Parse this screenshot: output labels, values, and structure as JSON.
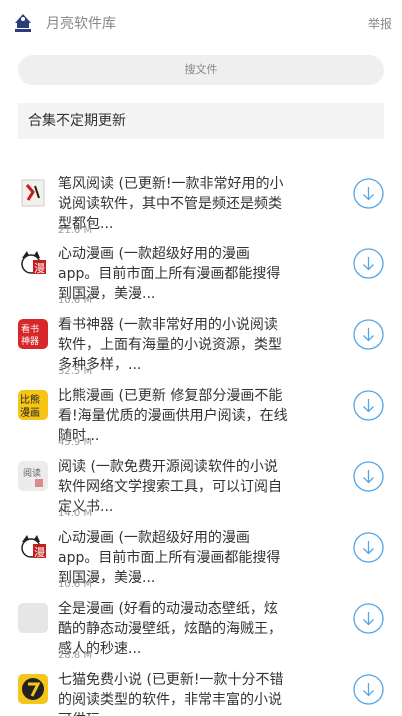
{
  "header": {
    "title": "月亮软件库",
    "report_label": "举报"
  },
  "search": {
    "placeholder": "搜文件"
  },
  "banner": {
    "text": "合集不定期更新"
  },
  "colors": {
    "accent": "#55a6e6",
    "icon_red": "#d62828",
    "icon_yellow": "#f5c518"
  },
  "items": [
    {
      "text": "笔风阅读 (已更新!一款非常好用的小说阅读软件，其中不管是频还是频类型都包...",
      "size": "21.6 M",
      "icon": "book-cover-icon"
    },
    {
      "text": "心动漫画 (一款超级好用的漫画app。目前市面上所有漫画都能搜得到国漫，美漫...",
      "size": "10.6 M",
      "icon": "manga-cat-icon"
    },
    {
      "text": "看书神器 (一款非常好用的小说阅读软件，上面有海量的小说资源，类型多种多样，...",
      "size": "32.5 M",
      "icon": "book-tool-icon"
    },
    {
      "text": "比熊漫画 (已更新 修复部分漫画不能看!海量优质的漫画供用户阅读，在线随时...",
      "size": "45.9 M",
      "icon": "bixiong-icon"
    },
    {
      "text": "阅读 (一款免费开源阅读软件的小说软件网络文学搜索工具，可以订阅自定义书...",
      "size": "14.0 M",
      "icon": "reader-icon"
    },
    {
      "text": "心动漫画 (一款超级好用的漫画app。目前市面上所有漫画都能搜得到国漫，美漫...",
      "size": "10.6 M",
      "icon": "manga-cat-icon"
    },
    {
      "text": "全是漫画 (好看的动漫动态壁纸，炫酷的静态动漫壁纸，炫酷的海贼王，感人的秒速...",
      "size": "28.8 M",
      "icon": "placeholder-icon"
    },
    {
      "text": "七猫免费小说 (已更新!一款十分不错的阅读类型的软件，非常丰富的小说可供玩...",
      "size": "",
      "icon": "seven-cat-icon"
    }
  ]
}
